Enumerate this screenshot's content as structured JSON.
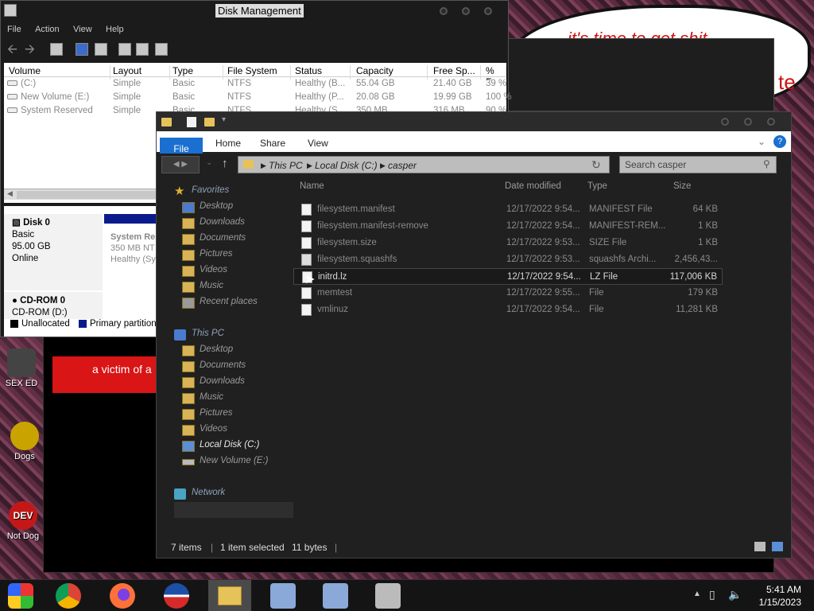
{
  "desktop": {
    "bubble_text": "it's time to get shit",
    "bubble_text_right": "te",
    "banner_text": "a victim of a",
    "icons": [
      {
        "label": "SEX ED"
      },
      {
        "label": "Dogs"
      },
      {
        "label": "Not Dog"
      }
    ]
  },
  "disk_management": {
    "title": "Disk Management",
    "menu": [
      "File",
      "Action",
      "View",
      "Help"
    ],
    "columns": [
      "Volume",
      "Layout",
      "Type",
      "File System",
      "Status",
      "Capacity",
      "Free Sp...",
      "% Fr"
    ],
    "rows": [
      {
        "volume": "(C:)",
        "layout": "Simple",
        "type": "Basic",
        "fs": "NTFS",
        "status": "Healthy (B...",
        "capacity": "55.04 GB",
        "free": "21.40 GB",
        "pct": "39 %"
      },
      {
        "volume": "New Volume (E:)",
        "layout": "Simple",
        "type": "Basic",
        "fs": "NTFS",
        "status": "Healthy (P...",
        "capacity": "20.08 GB",
        "free": "19.99 GB",
        "pct": "100 %"
      },
      {
        "volume": "System Reserved",
        "layout": "Simple",
        "type": "Basic",
        "fs": "NTFS",
        "status": "Healthy (S...",
        "capacity": "350 MB",
        "free": "316 MB",
        "pct": "90 %"
      }
    ],
    "disk0": {
      "name": "Disk 0",
      "type": "Basic",
      "size": "95.00 GB",
      "state": "Online"
    },
    "partition": {
      "name": "System Res",
      "size": "350 MB NT",
      "status": "Healthy (Sy"
    },
    "cdrom": {
      "name": "CD-ROM 0",
      "drive": "CD-ROM (D:)"
    },
    "legend": {
      "unallocated": "Unallocated",
      "primary": "Primary partition"
    }
  },
  "explorer": {
    "tabs": {
      "file": "File",
      "home": "Home",
      "share": "Share",
      "view": "View"
    },
    "breadcrumb": [
      "This PC",
      "Local Disk (C:)",
      "casper"
    ],
    "search_placeholder": "Search casper",
    "nav": {
      "favorites": "Favorites",
      "fav_items": [
        "Desktop",
        "Downloads",
        "Documents",
        "Pictures",
        "Videos",
        "Music",
        "Recent places"
      ],
      "this_pc": "This PC",
      "pc_items": [
        "Desktop",
        "Documents",
        "Downloads",
        "Music",
        "Pictures",
        "Videos",
        "Local Disk (C:)",
        "New Volume (E:)"
      ],
      "network": "Network"
    },
    "columns": {
      "name": "Name",
      "date": "Date modified",
      "type": "Type",
      "size": "Size"
    },
    "files": [
      {
        "name": "filesystem.manifest",
        "date": "12/17/2022 9:54...",
        "type": "MANIFEST File",
        "size": "64 KB"
      },
      {
        "name": "filesystem.manifest-remove",
        "date": "12/17/2022 9:54...",
        "type": "MANIFEST-REM...",
        "size": "1 KB"
      },
      {
        "name": "filesystem.size",
        "date": "12/17/2022 9:53...",
        "type": "SIZE File",
        "size": "1 KB"
      },
      {
        "name": "filesystem.squashfs",
        "date": "12/17/2022 9:53...",
        "type": "squashfs Archi...",
        "size": "2,456,43..."
      },
      {
        "name": "initrd.lz",
        "date": "12/17/2022 9:54...",
        "type": "LZ File",
        "size": "117,006 KB"
      },
      {
        "name": "memtest",
        "date": "12/17/2022 9:55...",
        "type": "File",
        "size": "179 KB"
      },
      {
        "name": "vmlinuz",
        "date": "12/17/2022 9:54...",
        "type": "File",
        "size": "11,281 KB"
      }
    ],
    "status": {
      "items": "7 items",
      "selected": "1 item selected",
      "bytes": "11 bytes"
    }
  },
  "taskbar": {
    "time": "5:41 AM",
    "date": "1/15/2023"
  }
}
